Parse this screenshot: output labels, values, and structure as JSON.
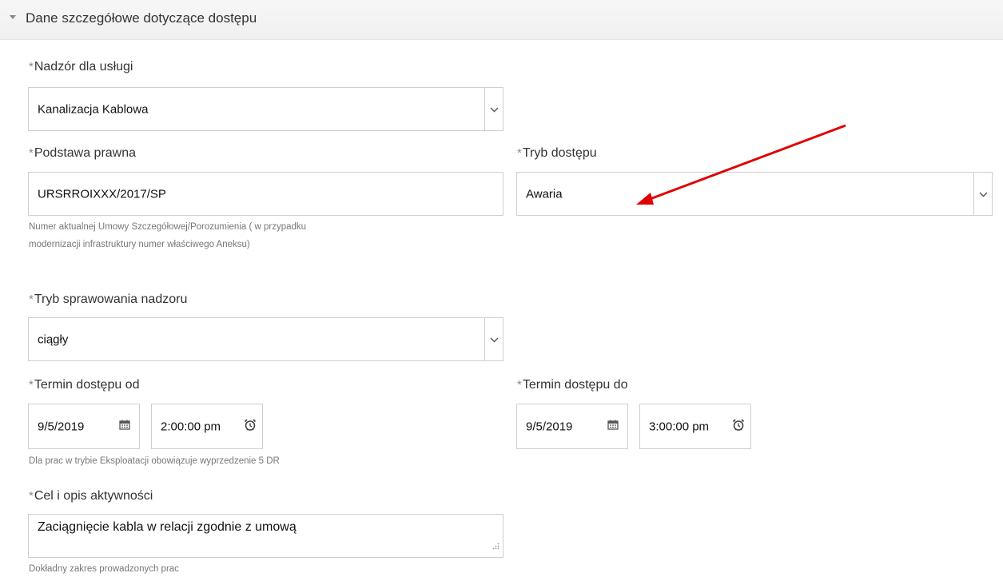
{
  "section": {
    "title": "Dane szczegółowe dotyczące dostępu",
    "caret_icon": "caret-down-icon"
  },
  "required_marker": "*",
  "nadzor": {
    "label": "Nadzór dla usługi",
    "value": "Kanalizacja Kablowa"
  },
  "podstawa": {
    "label": "Podstawa prawna",
    "value": "URSRROIXXX/2017/SP",
    "help_line1": "Numer aktualnej Umowy Szczegółowej/Porozumienia ( w przypadku",
    "help_line2": "modernizacji infrastruktury numer właściwego Aneksu)"
  },
  "tryb_dostepu": {
    "label": "Tryb dostępu",
    "value": "Awaria"
  },
  "tryb_nadzoru": {
    "label": "Tryb sprawowania nadzoru",
    "value": "ciągły"
  },
  "termin_od": {
    "label": "Termin dostępu od",
    "date": "9/5/2019",
    "time": "2:00:00 pm"
  },
  "termin_do": {
    "label": "Termin dostępu do",
    "date": "9/5/2019",
    "time": "3:00:00 pm"
  },
  "termin_help": "Dla prac w trybie Eksploatacji obowiązuje wyprzedzenie 5 DR",
  "cel": {
    "label": "Cel i opis aktywności",
    "value": "Zaciągnięcie kabla w relacji zgodnie z umową",
    "help": "Dokładny zakres prowadzonych prac"
  },
  "annotation": {
    "arrow_color": "#e00000"
  }
}
